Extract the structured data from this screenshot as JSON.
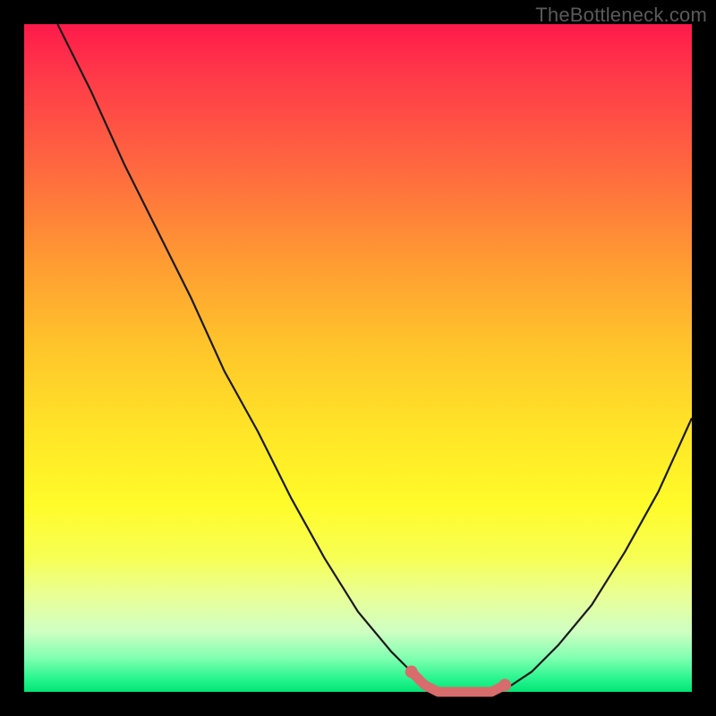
{
  "watermark": "TheBottleneck.com",
  "colors": {
    "page_bg": "#000000",
    "curve_stroke": "#1a1a1a",
    "marker_stroke": "#d86b6b",
    "marker_fill": "#d86b6b"
  },
  "chart_data": {
    "type": "line",
    "title": "",
    "xlabel": "",
    "ylabel": "",
    "xlim": [
      0,
      100
    ],
    "ylim": [
      0,
      100
    ],
    "grid": false,
    "legend": false,
    "series": [
      {
        "name": "curve",
        "x": [
          5,
          10,
          15,
          20,
          25,
          30,
          35,
          40,
          45,
          50,
          55,
          58,
          60,
          62,
          65,
          68,
          70,
          73,
          76,
          80,
          85,
          90,
          95,
          100
        ],
        "y": [
          100,
          90,
          79,
          69,
          59,
          48,
          39,
          29,
          20,
          12,
          6,
          3,
          1,
          0,
          0,
          0,
          0,
          1,
          3,
          7,
          13,
          21,
          30,
          41
        ]
      }
    ],
    "markers": {
      "name": "highlight",
      "x": [
        58,
        60,
        62,
        64,
        66,
        68,
        70,
        72
      ],
      "y": [
        3,
        1,
        0,
        0,
        0,
        0,
        0,
        1
      ]
    }
  }
}
